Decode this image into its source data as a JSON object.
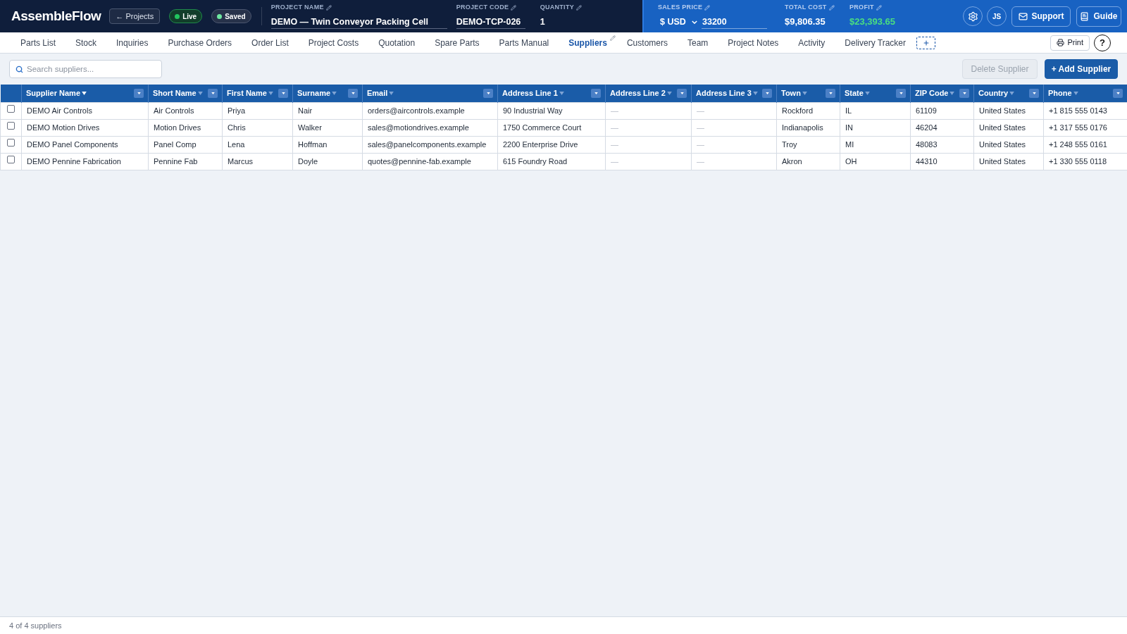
{
  "header": {
    "logo": "AssembleFlow",
    "back_button": "← Projects",
    "badges": [
      {
        "label": "Live",
        "kind": "live",
        "color": "#22c55e"
      },
      {
        "label": "Saved",
        "kind": "saved",
        "color": "#6ee7a0"
      }
    ],
    "fields": [
      {
        "label": "PROJECT NAME",
        "value": "DEMO — Twin Conveyor Packing Cell",
        "kind": "input"
      },
      {
        "label": "PROJECT CODE",
        "value": "DEMO-TCP-026",
        "kind": "input"
      },
      {
        "label": "QUANTITY",
        "value": "1",
        "kind": "plain"
      }
    ]
  },
  "pricing": {
    "sales_price": {
      "label": "SALES PRICE",
      "currency": "$ USD",
      "value": "33200"
    },
    "metrics": [
      {
        "label": "TOTAL COST",
        "value": "$9,806.35",
        "kind": "neutral"
      },
      {
        "label": "PROFIT",
        "value": "$23,393.65",
        "kind": "positive"
      }
    ]
  },
  "account": {
    "avatar": "JS",
    "buttons": [
      {
        "label": "Support",
        "kind": "support"
      },
      {
        "label": "Guide",
        "kind": "guide"
      }
    ]
  },
  "tabs": [
    {
      "label": "Parts List",
      "selected": false
    },
    {
      "label": "Stock",
      "selected": false
    },
    {
      "label": "Inquiries",
      "selected": false
    },
    {
      "label": "Purchase Orders",
      "selected": false
    },
    {
      "label": "Order List",
      "selected": false
    },
    {
      "label": "Project Costs",
      "selected": false
    },
    {
      "label": "Quotation",
      "selected": false
    },
    {
      "label": "Spare Parts",
      "selected": false
    },
    {
      "label": "Parts Manual",
      "selected": false
    },
    {
      "label": "Suppliers",
      "selected": true
    },
    {
      "label": "Customers",
      "selected": false
    },
    {
      "label": "Team",
      "selected": false
    },
    {
      "label": "Project Notes",
      "selected": false
    },
    {
      "label": "Activity",
      "selected": false
    },
    {
      "label": "Delivery Tracker",
      "selected": false
    }
  ],
  "tab_actions": {
    "print": "Print",
    "help": "?"
  },
  "toolbar": {
    "search": {
      "placeholder": "Search suppliers..."
    },
    "buttons": [
      {
        "label": "Delete Supplier",
        "kind": "secondary",
        "disabled": true
      },
      {
        "label": "+ Add Supplier",
        "kind": "primary",
        "disabled": false
      }
    ]
  },
  "table": {
    "columns": [
      {
        "label": "Supplier Name",
        "sorted": true
      },
      {
        "label": "Short Name",
        "sorted": false
      },
      {
        "label": "First Name",
        "sorted": false
      },
      {
        "label": "Surname",
        "sorted": false
      },
      {
        "label": "Email",
        "sorted": false
      },
      {
        "label": "Address Line 1",
        "sorted": false
      },
      {
        "label": "Address Line 2",
        "sorted": false
      },
      {
        "label": "Address Line 3",
        "sorted": false
      },
      {
        "label": "Town",
        "sorted": false
      },
      {
        "label": "State",
        "sorted": false
      },
      {
        "label": "ZIP Code",
        "sorted": false
      },
      {
        "label": "Country",
        "sorted": false
      },
      {
        "label": "Phone",
        "sorted": false
      }
    ],
    "rows": [
      {
        "checked": false,
        "cells": [
          {
            "text": "DEMO Air Controls",
            "empty": false
          },
          {
            "text": "Air Controls",
            "empty": false
          },
          {
            "text": "Priya",
            "empty": false
          },
          {
            "text": "Nair",
            "empty": false
          },
          {
            "text": "orders@aircontrols.example",
            "empty": false
          },
          {
            "text": "90 Industrial Way",
            "empty": false
          },
          {
            "text": "—",
            "empty": true
          },
          {
            "text": "—",
            "empty": true
          },
          {
            "text": "Rockford",
            "empty": false
          },
          {
            "text": "IL",
            "empty": false
          },
          {
            "text": "61109",
            "empty": false
          },
          {
            "text": "United States",
            "empty": false
          },
          {
            "text": "+1 815 555 0143",
            "empty": false
          }
        ]
      },
      {
        "checked": false,
        "cells": [
          {
            "text": "DEMO Motion Drives",
            "empty": false
          },
          {
            "text": "Motion Drives",
            "empty": false
          },
          {
            "text": "Chris",
            "empty": false
          },
          {
            "text": "Walker",
            "empty": false
          },
          {
            "text": "sales@motiondrives.example",
            "empty": false
          },
          {
            "text": "1750 Commerce Court",
            "empty": false
          },
          {
            "text": "—",
            "empty": true
          },
          {
            "text": "—",
            "empty": true
          },
          {
            "text": "Indianapolis",
            "empty": false
          },
          {
            "text": "IN",
            "empty": false
          },
          {
            "text": "46204",
            "empty": false
          },
          {
            "text": "United States",
            "empty": false
          },
          {
            "text": "+1 317 555 0176",
            "empty": false
          }
        ]
      },
      {
        "checked": false,
        "cells": [
          {
            "text": "DEMO Panel Components",
            "empty": false
          },
          {
            "text": "Panel Comp",
            "empty": false
          },
          {
            "text": "Lena",
            "empty": false
          },
          {
            "text": "Hoffman",
            "empty": false
          },
          {
            "text": "sales@panelcomponents.example",
            "empty": false
          },
          {
            "text": "2200 Enterprise Drive",
            "empty": false
          },
          {
            "text": "—",
            "empty": true
          },
          {
            "text": "—",
            "empty": true
          },
          {
            "text": "Troy",
            "empty": false
          },
          {
            "text": "MI",
            "empty": false
          },
          {
            "text": "48083",
            "empty": false
          },
          {
            "text": "United States",
            "empty": false
          },
          {
            "text": "+1 248 555 0161",
            "empty": false
          }
        ]
      },
      {
        "checked": false,
        "cells": [
          {
            "text": "DEMO Pennine Fabrication",
            "empty": false
          },
          {
            "text": "Pennine Fab",
            "empty": false
          },
          {
            "text": "Marcus",
            "empty": false
          },
          {
            "text": "Doyle",
            "empty": false
          },
          {
            "text": "quotes@pennine-fab.example",
            "empty": false
          },
          {
            "text": "615 Foundry Road",
            "empty": false
          },
          {
            "text": "—",
            "empty": true
          },
          {
            "text": "—",
            "empty": true
          },
          {
            "text": "Akron",
            "empty": false
          },
          {
            "text": "OH",
            "empty": false
          },
          {
            "text": "44310",
            "empty": false
          },
          {
            "text": "United States",
            "empty": false
          },
          {
            "text": "+1 330 555 0118",
            "empty": false
          }
        ]
      }
    ]
  },
  "status_bar": "4 of 4 suppliers"
}
